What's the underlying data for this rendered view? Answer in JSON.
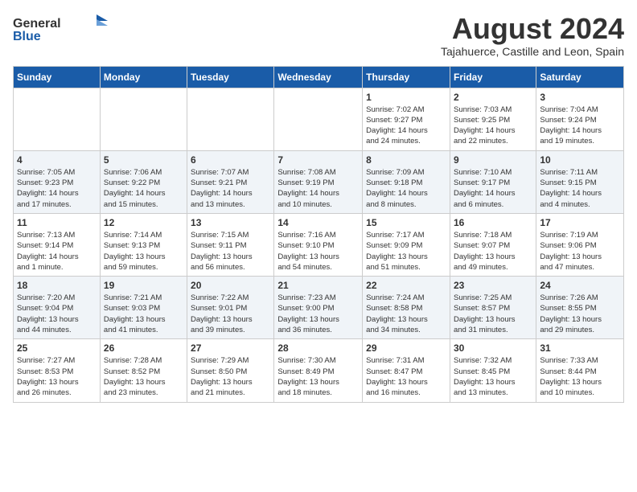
{
  "header": {
    "logo_general": "General",
    "logo_blue": "Blue",
    "month_year": "August 2024",
    "location": "Tajahuerce, Castille and Leon, Spain"
  },
  "weekdays": [
    "Sunday",
    "Monday",
    "Tuesday",
    "Wednesday",
    "Thursday",
    "Friday",
    "Saturday"
  ],
  "weeks": [
    [
      {
        "day": "",
        "info": ""
      },
      {
        "day": "",
        "info": ""
      },
      {
        "day": "",
        "info": ""
      },
      {
        "day": "",
        "info": ""
      },
      {
        "day": "1",
        "info": "Sunrise: 7:02 AM\nSunset: 9:27 PM\nDaylight: 14 hours\nand 24 minutes."
      },
      {
        "day": "2",
        "info": "Sunrise: 7:03 AM\nSunset: 9:25 PM\nDaylight: 14 hours\nand 22 minutes."
      },
      {
        "day": "3",
        "info": "Sunrise: 7:04 AM\nSunset: 9:24 PM\nDaylight: 14 hours\nand 19 minutes."
      }
    ],
    [
      {
        "day": "4",
        "info": "Sunrise: 7:05 AM\nSunset: 9:23 PM\nDaylight: 14 hours\nand 17 minutes."
      },
      {
        "day": "5",
        "info": "Sunrise: 7:06 AM\nSunset: 9:22 PM\nDaylight: 14 hours\nand 15 minutes."
      },
      {
        "day": "6",
        "info": "Sunrise: 7:07 AM\nSunset: 9:21 PM\nDaylight: 14 hours\nand 13 minutes."
      },
      {
        "day": "7",
        "info": "Sunrise: 7:08 AM\nSunset: 9:19 PM\nDaylight: 14 hours\nand 10 minutes."
      },
      {
        "day": "8",
        "info": "Sunrise: 7:09 AM\nSunset: 9:18 PM\nDaylight: 14 hours\nand 8 minutes."
      },
      {
        "day": "9",
        "info": "Sunrise: 7:10 AM\nSunset: 9:17 PM\nDaylight: 14 hours\nand 6 minutes."
      },
      {
        "day": "10",
        "info": "Sunrise: 7:11 AM\nSunset: 9:15 PM\nDaylight: 14 hours\nand 4 minutes."
      }
    ],
    [
      {
        "day": "11",
        "info": "Sunrise: 7:13 AM\nSunset: 9:14 PM\nDaylight: 14 hours\nand 1 minute."
      },
      {
        "day": "12",
        "info": "Sunrise: 7:14 AM\nSunset: 9:13 PM\nDaylight: 13 hours\nand 59 minutes."
      },
      {
        "day": "13",
        "info": "Sunrise: 7:15 AM\nSunset: 9:11 PM\nDaylight: 13 hours\nand 56 minutes."
      },
      {
        "day": "14",
        "info": "Sunrise: 7:16 AM\nSunset: 9:10 PM\nDaylight: 13 hours\nand 54 minutes."
      },
      {
        "day": "15",
        "info": "Sunrise: 7:17 AM\nSunset: 9:09 PM\nDaylight: 13 hours\nand 51 minutes."
      },
      {
        "day": "16",
        "info": "Sunrise: 7:18 AM\nSunset: 9:07 PM\nDaylight: 13 hours\nand 49 minutes."
      },
      {
        "day": "17",
        "info": "Sunrise: 7:19 AM\nSunset: 9:06 PM\nDaylight: 13 hours\nand 47 minutes."
      }
    ],
    [
      {
        "day": "18",
        "info": "Sunrise: 7:20 AM\nSunset: 9:04 PM\nDaylight: 13 hours\nand 44 minutes."
      },
      {
        "day": "19",
        "info": "Sunrise: 7:21 AM\nSunset: 9:03 PM\nDaylight: 13 hours\nand 41 minutes."
      },
      {
        "day": "20",
        "info": "Sunrise: 7:22 AM\nSunset: 9:01 PM\nDaylight: 13 hours\nand 39 minutes."
      },
      {
        "day": "21",
        "info": "Sunrise: 7:23 AM\nSunset: 9:00 PM\nDaylight: 13 hours\nand 36 minutes."
      },
      {
        "day": "22",
        "info": "Sunrise: 7:24 AM\nSunset: 8:58 PM\nDaylight: 13 hours\nand 34 minutes."
      },
      {
        "day": "23",
        "info": "Sunrise: 7:25 AM\nSunset: 8:57 PM\nDaylight: 13 hours\nand 31 minutes."
      },
      {
        "day": "24",
        "info": "Sunrise: 7:26 AM\nSunset: 8:55 PM\nDaylight: 13 hours\nand 29 minutes."
      }
    ],
    [
      {
        "day": "25",
        "info": "Sunrise: 7:27 AM\nSunset: 8:53 PM\nDaylight: 13 hours\nand 26 minutes."
      },
      {
        "day": "26",
        "info": "Sunrise: 7:28 AM\nSunset: 8:52 PM\nDaylight: 13 hours\nand 23 minutes."
      },
      {
        "day": "27",
        "info": "Sunrise: 7:29 AM\nSunset: 8:50 PM\nDaylight: 13 hours\nand 21 minutes."
      },
      {
        "day": "28",
        "info": "Sunrise: 7:30 AM\nSunset: 8:49 PM\nDaylight: 13 hours\nand 18 minutes."
      },
      {
        "day": "29",
        "info": "Sunrise: 7:31 AM\nSunset: 8:47 PM\nDaylight: 13 hours\nand 16 minutes."
      },
      {
        "day": "30",
        "info": "Sunrise: 7:32 AM\nSunset: 8:45 PM\nDaylight: 13 hours\nand 13 minutes."
      },
      {
        "day": "31",
        "info": "Sunrise: 7:33 AM\nSunset: 8:44 PM\nDaylight: 13 hours\nand 10 minutes."
      }
    ]
  ]
}
